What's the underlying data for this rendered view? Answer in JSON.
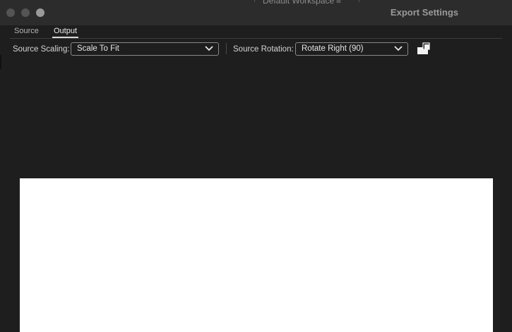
{
  "window": {
    "title": "Export Settings",
    "background_workspace_label": "Default Workspace",
    "background_menu_glyph": "≡"
  },
  "tabs": [
    {
      "label": "Source",
      "active": false
    },
    {
      "label": "Output",
      "active": true
    }
  ],
  "toolbar": {
    "scaling_label": "Source Scaling:",
    "scaling_value": "Scale To Fit",
    "rotation_label": "Source Rotation:",
    "rotation_value": "Rotate Right (90)",
    "crop_icon": "crop-output-icon"
  },
  "colors": {
    "background": "#1e1e1e",
    "titlebar": "#2c2c2c",
    "preview": "#ffffff",
    "title_text": "#9a9a9a"
  }
}
